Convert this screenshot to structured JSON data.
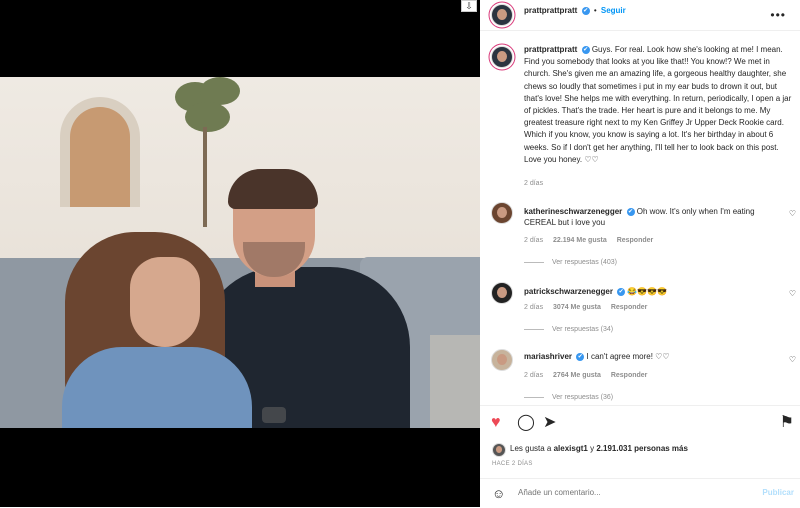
{
  "post": {
    "username": "prattprattpratt",
    "follow_label": "Seguir",
    "caption": "Guys. For real. Look how she's looking at me! I mean. Find you somebody that looks at you like that!! You know!? We met in church. She's given me an amazing life, a gorgeous healthy daughter, she chews so loudly that sometimes i put in my ear buds to drown it out, but that's love! She helps me with everything. In return, periodically, I open a jar of pickles. That's the trade. Her heart is pure and it belongs to me. My greatest treasure right next to my Ken Griffey Jr Upper Deck Rookie card. Which if you know, you know is saying a lot. It's her birthday in about 6 weeks. So if I don't get her anything, I'll tell her to look back on this post. Love you honey. ♡♡",
    "caption_time": "2 días"
  },
  "comments": [
    {
      "username": "katherineschwarzenegger",
      "text": "Oh wow. It's only when I'm eating CEREAL but i love you",
      "time": "2 días",
      "likes": "22.194 Me gusta",
      "reply": "Responder",
      "view_replies": "Ver respuestas (403)"
    },
    {
      "username": "patrickschwarzenegger",
      "text": "😂😎😎😎",
      "time": "2 días",
      "likes": "3074 Me gusta",
      "reply": "Responder",
      "view_replies": "Ver respuestas (34)"
    },
    {
      "username": "mariashriver",
      "text": "I can't agree more! ♡♡",
      "time": "2 días",
      "likes": "2764 Me gusta",
      "reply": "Responder",
      "view_replies": "Ver respuestas (36)"
    }
  ],
  "likes": {
    "prefix": "Les gusta a",
    "user": "alexisgt1",
    "middle": "y",
    "count": "2.191.031 personas más"
  },
  "time_ago": "HACE 2 DÍAS",
  "add_comment": {
    "placeholder": "Añade un comentario...",
    "publish_label": "Publicar"
  },
  "colors": {
    "verified": "#3897f0",
    "like_red": "#ed4956",
    "link_blue": "#0095f6"
  },
  "icons": {
    "verified": "✔",
    "heart": "♥",
    "comment": "◯",
    "share": "➤",
    "bookmark": "⚑",
    "more": "•••",
    "emoji": "☺",
    "download": "⇩",
    "small_heart": "♡"
  }
}
